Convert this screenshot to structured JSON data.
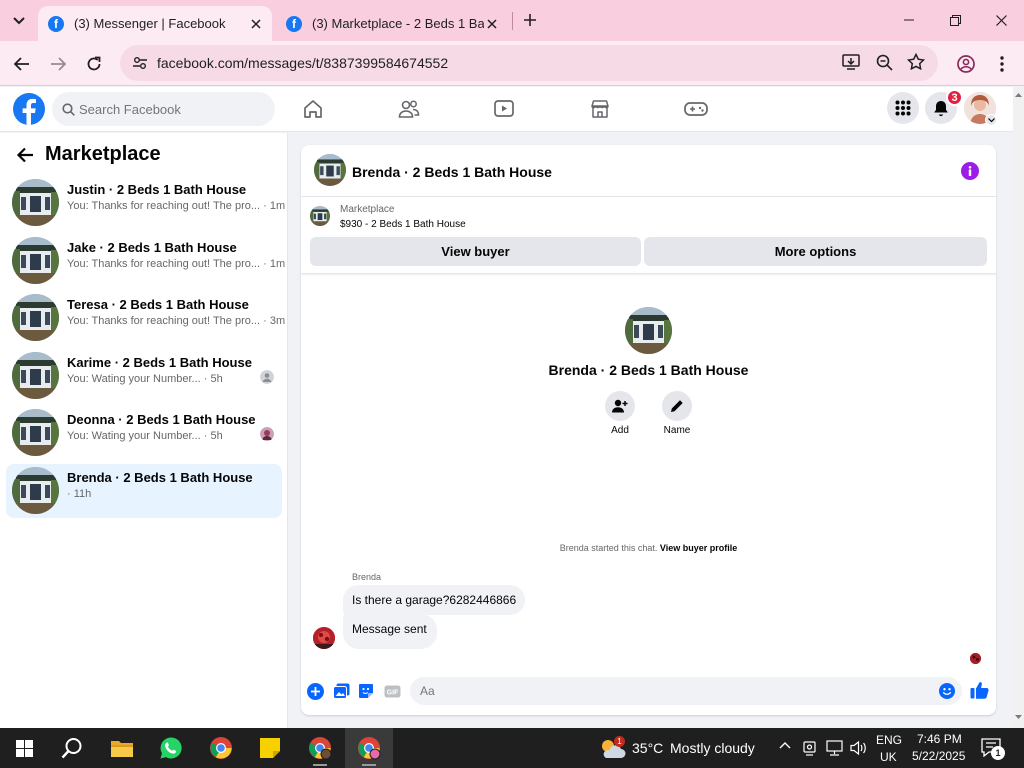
{
  "browser": {
    "tabs": [
      {
        "title": "(3) Messenger | Facebook",
        "active": true
      },
      {
        "title": "(3) Marketplace - 2 Beds 1 Bath",
        "active": false
      }
    ],
    "url": "facebook.com/messages/t/8387399584674552"
  },
  "fb": {
    "search_placeholder": "Search Facebook",
    "notification_count": "3",
    "brand_color": "#1877f2"
  },
  "sidebar": {
    "title": "Marketplace",
    "conversations": [
      {
        "name": "Justin · 2 Beds 1 Bath House",
        "preview": "You: Thanks for reaching out! The pro...",
        "time": " · 1m"
      },
      {
        "name": "Jake · 2 Beds 1 Bath House",
        "preview": "You: Thanks for reaching out! The pro...",
        "time": " · 1m"
      },
      {
        "name": "Teresa · 2 Beds 1 Bath House",
        "preview": "You: Thanks for reaching out! The pro...",
        "time": " · 3m"
      },
      {
        "name": "Karime · 2 Beds 1 Bath House",
        "preview": "You: Wating your Number...",
        "time": " · 5h"
      },
      {
        "name": "Deonna · 2 Beds 1 Bath House",
        "preview": "You: Wating your Number...",
        "time": " · 5h"
      },
      {
        "name": "Brenda · 2 Beds 1 Bath House",
        "preview": "",
        "time": "· 11h"
      }
    ]
  },
  "chat": {
    "title": "Brenda · 2 Beds 1 Bath House",
    "marketplace_label": "Marketplace",
    "listing": "$930 - 2 Beds 1 Bath House",
    "view_buyer": "View buyer",
    "more_options": "More options",
    "profile_name": "Brenda · 2 Beds 1 Bath House",
    "add_label": "Add",
    "name_label": "Name",
    "started_text": "Brenda started this chat.",
    "view_profile_link": "View buyer profile",
    "sender": "Brenda",
    "messages": [
      "Is there a garage?6282446866",
      "Message sent"
    ],
    "composer_placeholder": "Aa"
  },
  "taskbar": {
    "weather_temp": "35°C",
    "weather_text": "Mostly cloudy",
    "weather_badge": "1",
    "lang_top": "ENG",
    "lang_bottom": "UK",
    "time": "7:46 PM",
    "date": "5/22/2025",
    "notification_badge": "1"
  }
}
